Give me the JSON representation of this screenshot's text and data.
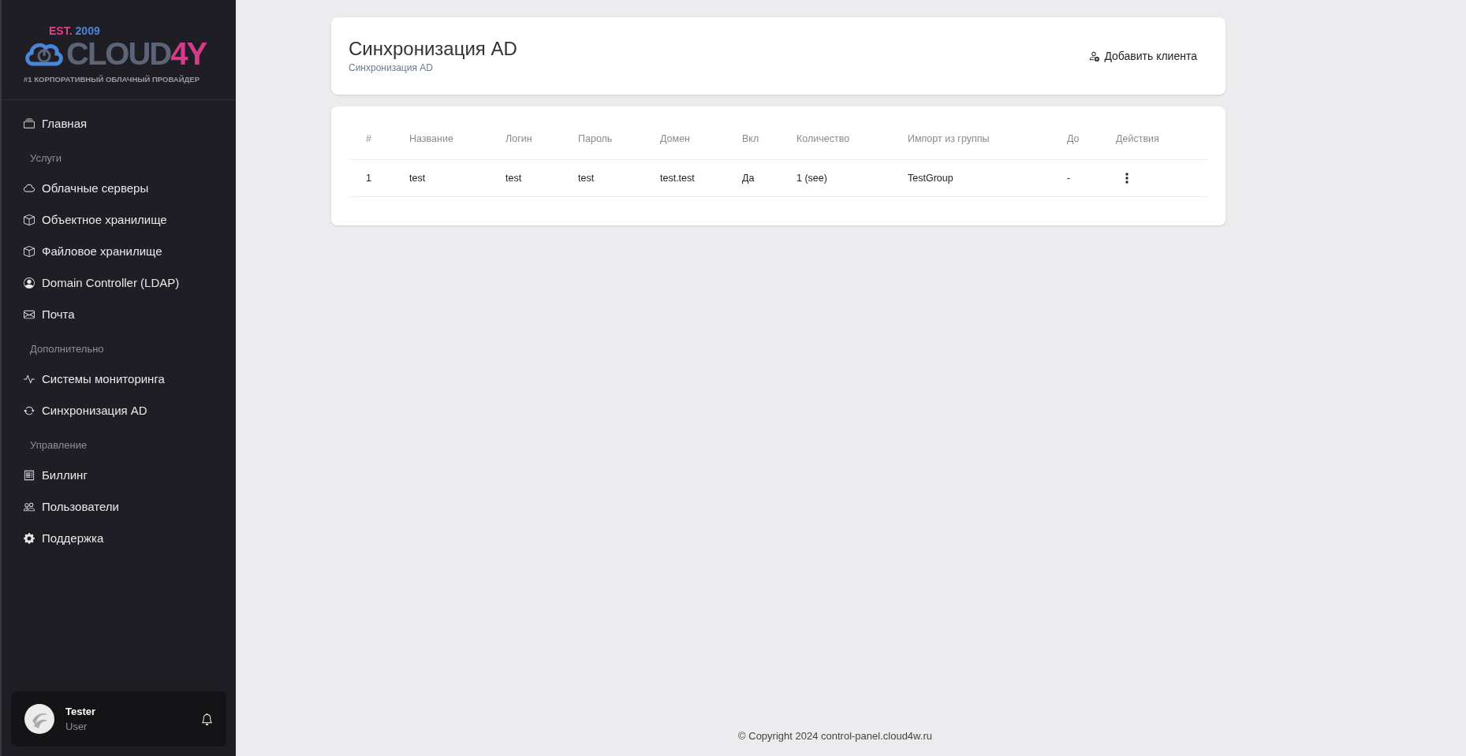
{
  "logo": {
    "est": "EST.",
    "year": "2009",
    "name": "CLOUD",
    "name_accent": "4Y",
    "tagline": "#1 КОРПОРАТИВНЫЙ ОБЛАЧНЫЙ ПРОВАЙДЕР"
  },
  "sidebar": {
    "items": [
      {
        "kind": "link",
        "label": "Главная"
      },
      {
        "kind": "section",
        "label": "Услуги"
      },
      {
        "kind": "link",
        "label": "Облачные серверы"
      },
      {
        "kind": "link",
        "label": "Объектное хранилище"
      },
      {
        "kind": "link",
        "label": "Файловое хранилище"
      },
      {
        "kind": "link",
        "label": "Domain Controller (LDAP)"
      },
      {
        "kind": "link",
        "label": "Почта"
      },
      {
        "kind": "section",
        "label": "Дополнительно"
      },
      {
        "kind": "link",
        "label": "Системы мониторинга"
      },
      {
        "kind": "link",
        "label": "Синхронизация AD"
      },
      {
        "kind": "section",
        "label": "Управление"
      },
      {
        "kind": "link",
        "label": "Биллинг"
      },
      {
        "kind": "link",
        "label": "Пользователи"
      },
      {
        "kind": "link",
        "label": "Поддержка"
      }
    ]
  },
  "user": {
    "name": "Tester",
    "role": "User"
  },
  "header": {
    "title": "Синхронизация AD",
    "breadcrumb": "Синхронизация AD",
    "add_button": "Добавить клиента"
  },
  "table": {
    "columns": [
      "#",
      "Название",
      "Логин",
      "Пароль",
      "Домен",
      "Вкл",
      "Количество",
      "Импорт из группы",
      "До",
      "Действия"
    ],
    "rows": [
      {
        "cells": [
          "1",
          "test",
          "test",
          "test",
          "test.test",
          "Да",
          "1 (see)",
          "TestGroup",
          "-"
        ]
      }
    ]
  },
  "footer": "© Copyright 2024 control-panel.cloud4w.ru"
}
